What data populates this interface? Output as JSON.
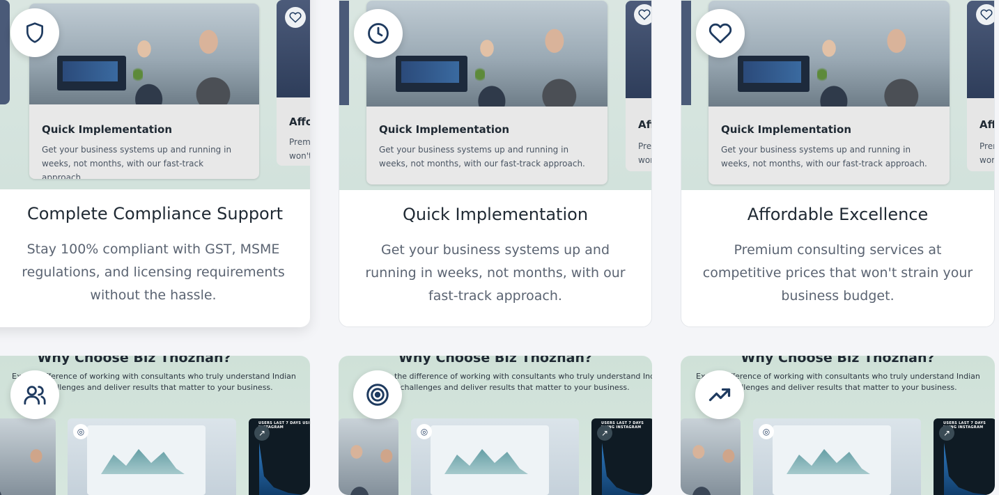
{
  "cards": [
    {
      "title": "Complete Compliance Support",
      "description": "Stay 100% compliant with GST, MSME regulations, and licensing requirements without the hassle.",
      "icon": "shield-icon",
      "preview": {
        "main_title": "Quick Implementation",
        "main_desc": "Get your business systems up and running in weeks, not months, with our fast-track approach.",
        "side_title": "Affo",
        "side_desc_1": "Premi",
        "side_desc_2": "won't"
      }
    },
    {
      "title": "Quick Implementation",
      "description": "Get your business systems up and running in weeks, not months, with our fast-track approach.",
      "icon": "clock-icon",
      "preview": {
        "main_title": "Quick Implementation",
        "main_desc": "Get your business systems up and running in weeks, not months, with our fast-track approach.",
        "side_title": "Aff",
        "side_desc_1": "Prer",
        "side_desc_2": "wor"
      }
    },
    {
      "title": "Affordable Excellence",
      "description": "Premium consulting services at competitive prices that won't strain your business budget.",
      "icon": "heart-icon",
      "preview": {
        "main_title": "Quick Implementation",
        "main_desc": "Get your business systems up and running in weeks, not months, with our fast-track approach.",
        "side_title": "Aff",
        "side_desc_1": "Prer",
        "side_desc_2": "wor"
      }
    }
  ],
  "bottom_cards": [
    {
      "heading": "Why Choose Biz Thozhan?",
      "sub_1": "Ex     the difference of working with consultants who truly understand Indian",
      "sub_2": "E challenges and deliver results that matter to your business.",
      "icon": "users-icon",
      "dark_text": "USERS LAST 7 DAYS USING INSTAGRAM"
    },
    {
      "heading": "Why Choose Biz Thozhan?",
      "sub_1": "the difference of working with consultants who truly understand Indian",
      "sub_2": "E challenges and deliver results that matter to your business.",
      "icon": "target-icon",
      "dark_text": "USERS LAST 7 DAYS USING INSTAGRAM"
    },
    {
      "heading": "Why Choose Biz Thozhan?",
      "sub_1": "Ex     the difference of working with consultants who truly understand Indian",
      "sub_2": "E challenges and deliver results that matter to your business.",
      "icon": "trending-up-icon",
      "dark_text": "USERS LAST 7 DAYS USING INSTAGRAM"
    }
  ],
  "colors": {
    "accent": "#1e3a5f",
    "text_dark": "#1f2933",
    "text_muted": "#5b6472"
  }
}
